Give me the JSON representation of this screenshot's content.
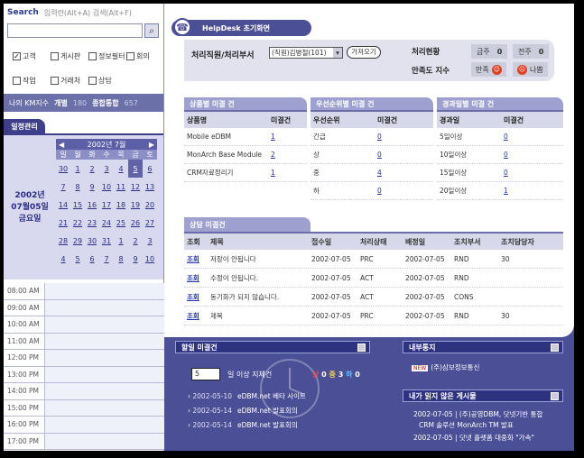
{
  "search": {
    "label": "Search",
    "hint": "입력란(Alt+A) 검색(Alt+F)",
    "value": ""
  },
  "filters": [
    {
      "label": "고객",
      "checked": true
    },
    {
      "label": "게시판",
      "checked": false
    },
    {
      "label": "정보필터",
      "checked": false
    },
    {
      "label": "회의",
      "checked": false
    },
    {
      "label": "작업",
      "checked": false
    },
    {
      "label": "거래처",
      "checked": false
    },
    {
      "label": "상담",
      "checked": false
    }
  ],
  "km": {
    "label": "나의 KM지수",
    "tab1": "개별",
    "v1": "180",
    "tab2": "종합통합",
    "v2": "657"
  },
  "schedule": {
    "tab": "일정관리",
    "date_lines": [
      "2002년",
      "07월05일",
      "금요일"
    ],
    "cal_title": "2002년 7월",
    "prev": "◀",
    "next": "▶",
    "dow": [
      "일",
      "월",
      "화",
      "수",
      "목",
      "금",
      "토"
    ],
    "days": [
      "30",
      "1",
      "2",
      "3",
      "4",
      "5",
      "6",
      "7",
      "8",
      "9",
      "10",
      "11",
      "12",
      "13",
      "14",
      "15",
      "16",
      "17",
      "18",
      "19",
      "20",
      "21",
      "22",
      "23",
      "24",
      "25",
      "26",
      "27",
      "28",
      "29",
      "30",
      "31",
      "1",
      "2",
      "3",
      "4",
      "5",
      "6",
      "7",
      "8",
      "9",
      "10"
    ],
    "times": [
      "08:00 AM",
      "09:00 AM",
      "10:00 AM",
      "11:00 AM",
      "12:00 PM",
      "13:00 PM",
      "14:00 PM",
      "15:00 PM",
      "16:00 PM",
      "17:00 PM"
    ]
  },
  "helpdesk": {
    "title": "HelpDesk 초기화면",
    "dept_label": "처리직원/처리부서",
    "dept_value": "(직원)김병철(101)",
    "go": "가져오기",
    "status_label": "처리현황",
    "sat_label": "만족도 지수",
    "today": "금주",
    "today_v": "0",
    "prev": "전주",
    "prev_v": "0",
    "s1": "만족",
    "s2": "나쁨"
  },
  "product_panel": {
    "tab": "상품별 미결 건",
    "headers": [
      "상품명",
      "미결건"
    ],
    "rows": [
      [
        "Mobile eDBM",
        "1"
      ],
      [
        "MonArch Base Module",
        "2"
      ],
      [
        "CRM자료정리기",
        "1"
      ]
    ]
  },
  "priority_panel": {
    "tab": "우선순위별 미결 건",
    "headers": [
      "우선순위",
      "미결건"
    ],
    "rows": [
      [
        "긴급",
        "0"
      ],
      [
        "상",
        "0"
      ],
      [
        "중",
        "4"
      ],
      [
        "하",
        "0"
      ]
    ]
  },
  "elapsed_panel": {
    "tab": "경과일별 미결 건",
    "headers": [
      "경과일",
      "미결건"
    ],
    "rows": [
      [
        "5일이상",
        "0"
      ],
      [
        "10일이상",
        "0"
      ],
      [
        "15일이상",
        "0"
      ],
      [
        "20일이상",
        "1"
      ]
    ]
  },
  "consult": {
    "tab": "상담 미결건",
    "headers": [
      "조회",
      "제목",
      "접수일",
      "처리상태",
      "배정일",
      "조치부서",
      "조치담당자"
    ],
    "rows": [
      [
        "조회",
        "저장이 안됩니다",
        "2002-07-05",
        "PRC",
        "2002-07-05",
        "RND",
        "30"
      ],
      [
        "조회",
        "수정이 안됩니다.",
        "2002-07-05",
        "ACT",
        "2002-07-05",
        "RND",
        ""
      ],
      [
        "조회",
        "동기화가 되지 않습니다.",
        "2002-07-05",
        "ACT",
        "2002-07-05",
        "CONS",
        ""
      ],
      [
        "조회",
        "제목",
        "2002-07-05",
        "PRC",
        "2002-07-05",
        "RND",
        "30"
      ]
    ]
  },
  "lower": {
    "work_title": "할일 미결건",
    "count_value": "5",
    "count_label": "일 이상 지체건",
    "prio": [
      "상",
      "0",
      "중",
      "3",
      "하",
      "0"
    ],
    "news": [
      {
        "date": "2002-05-10",
        "text": "eDBM.net 베타 사이트"
      },
      {
        "date": "2002-05-14",
        "text": "eDBM.net 발표회의"
      },
      {
        "date": "2002-05-14",
        "text": "eDBM.net 발표회의"
      }
    ],
    "notice_title": "내부통지",
    "notice_badge": "NEW",
    "notice_text": "(주)삼보정보통신",
    "unread_title": "내가 읽지 않은 게시물",
    "unread": [
      "2002-07-05 | (주)공영DBM, 닷넷기반 통합",
      "CRM 솔루션 MonArch TM 발표",
      "2002-07-05 | 닷넷 플랫폼 대중화 \"가속\""
    ]
  }
}
